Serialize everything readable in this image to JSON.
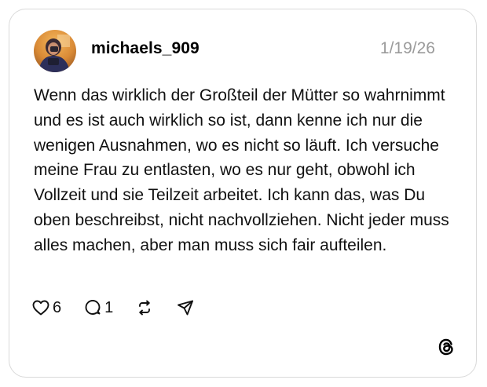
{
  "post": {
    "username": "michaels_909",
    "date": "1/19/26",
    "text": "Wenn das wirklich der Großteil der Mütter so wahrnimmt und es ist auch wirklich so ist, dann kenne ich nur die wenigen Ausnahmen, wo es nicht so läuft. Ich versuche meine Frau zu entlasten, wo es nur geht, obwohl ich Vollzeit und sie Teilzeit arbeitet. Ich kann das, was Du oben beschreibst, nicht nachvollziehen. Nicht jeder muss alles machen, aber man muss sich fair aufteilen."
  },
  "actions": {
    "like_icon": "heart-icon",
    "like_count": "6",
    "reply_icon": "comment-bubble-icon",
    "reply_count": "1",
    "repost_icon": "repost-icon",
    "share_icon": "send-icon"
  },
  "brand": {
    "logo_icon": "threads-logo-icon"
  },
  "colors": {
    "border": "#d9d9d9",
    "date": "#9a9a9a",
    "text": "#111111"
  }
}
